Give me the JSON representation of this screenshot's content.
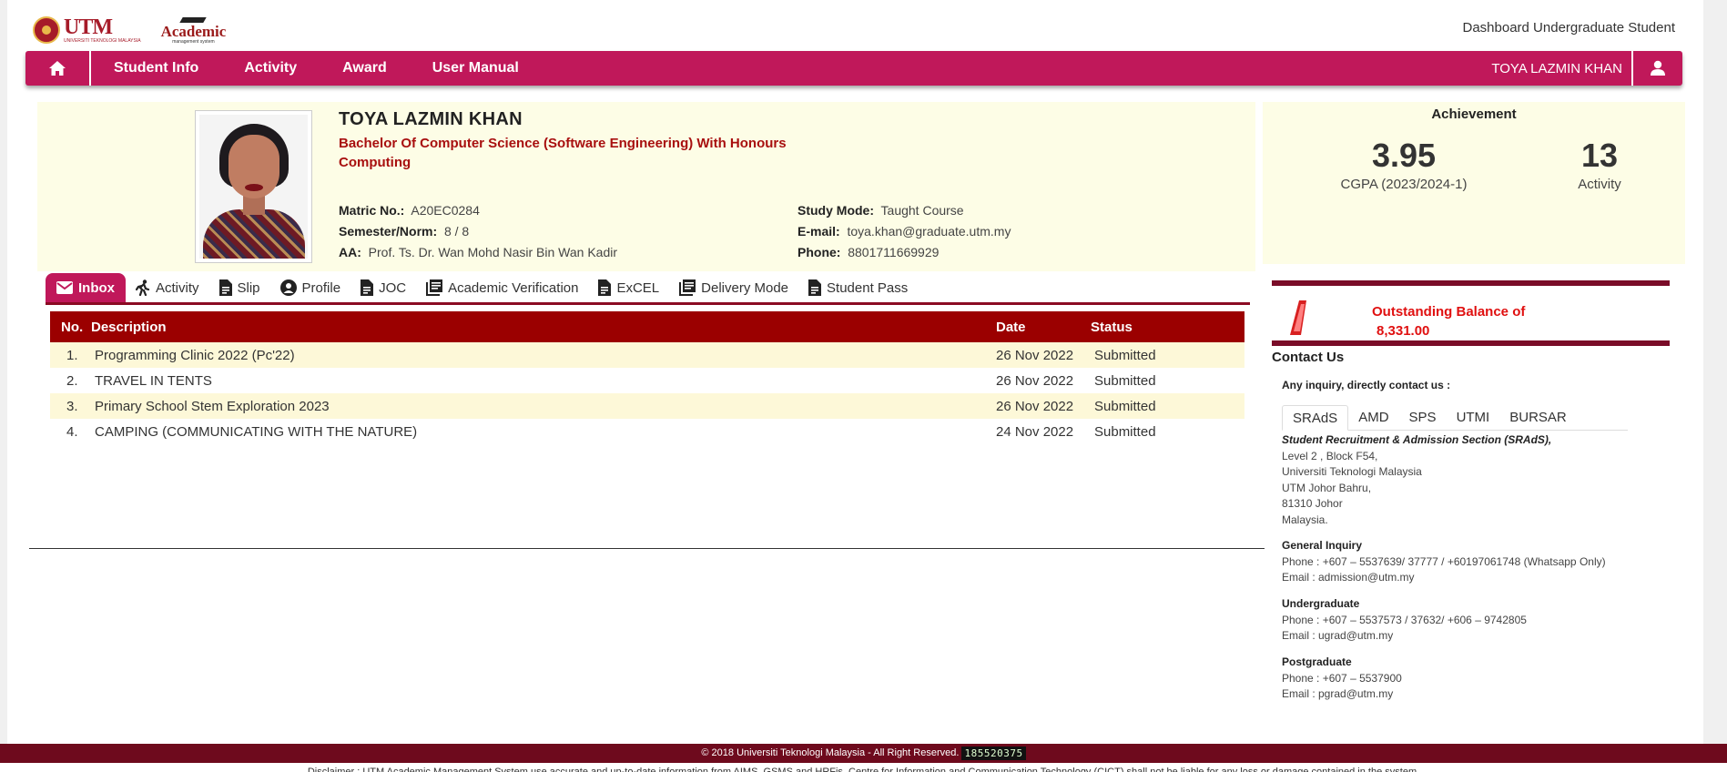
{
  "header": {
    "utm_logo_text": "UTM",
    "utm_logo_sub": "UNIVERSITI TEKNOLOGI MALAYSIA",
    "acad_logo_text": "Academic",
    "acad_logo_sub": "management system",
    "dashboard_title": "Dashboard Undergraduate Student"
  },
  "nav": {
    "items": [
      "Student Info",
      "Activity",
      "Award",
      "User Manual"
    ],
    "user_name": "TOYA LAZMIN KHAN"
  },
  "profile": {
    "name": "TOYA LAZMIN KHAN",
    "programme": "Bachelor Of Computer Science (Software Engineering) With Honours",
    "faculty": "Computing",
    "matric_label": "Matric No.:",
    "matric_value": "A20EC0284",
    "semester_label": "Semester/Norm:",
    "semester_value": "8 / 8",
    "aa_label": "AA:",
    "aa_value": "Prof. Ts. Dr. Wan Mohd Nasir Bin Wan Kadir",
    "mode_label": "Study Mode:",
    "mode_value": "Taught Course",
    "email_label": "E-mail:",
    "email_value": "toya.khan@graduate.utm.my",
    "phone_label": "Phone:",
    "phone_value": "8801711669929"
  },
  "achievement": {
    "title": "Achievement",
    "cgpa_value": "3.95",
    "cgpa_label": "CGPA (2023/2024-1)",
    "activity_value": "13",
    "activity_label": "Activity"
  },
  "outstanding": {
    "label": "Outstanding Balance of",
    "amount": "8,331.00"
  },
  "tabs": [
    "Inbox",
    "Activity",
    "Slip",
    "Profile",
    "JOC",
    "Academic Verification",
    "ExCEL",
    "Delivery Mode",
    "Student Pass"
  ],
  "inbox": {
    "headers": [
      "No.",
      "Description",
      "Date",
      "Status"
    ],
    "rows": [
      {
        "no": "1.",
        "description": "Programming Clinic 2022 (Pc'22)",
        "date": "26 Nov 2022",
        "status": "Submitted"
      },
      {
        "no": "2.",
        "description": "TRAVEL IN TENTS",
        "date": "26 Nov 2022",
        "status": "Submitted"
      },
      {
        "no": "3.",
        "description": "Primary School Stem Exploration 2023",
        "date": "26 Nov 2022",
        "status": "Submitted"
      },
      {
        "no": "4.",
        "description": "CAMPING (COMMUNICATING WITH THE NATURE)",
        "date": "24 Nov 2022",
        "status": "Submitted"
      }
    ]
  },
  "contact": {
    "title": "Contact Us",
    "subtitle": "Any inquiry, directly contact us :",
    "tabs": [
      "SRAdS",
      "AMD",
      "SPS",
      "UTMI",
      "BURSAR"
    ],
    "section_name": "Student Recruitment & Admission Section (SRAdS),",
    "address": [
      "Level 2 , Block F54,",
      "Universiti Teknologi Malaysia",
      "UTM Johor Bahru,",
      "81310 Johor",
      "Malaysia."
    ],
    "general_title": "General Inquiry",
    "general_phone": "Phone : +607 – 5537639/ 37777 / +60197061748 (Whatsapp Only)",
    "general_email": "Email : admission@utm.my",
    "ug_title": "Undergraduate",
    "ug_phone": "Phone : +607 – 5537573 / 37632/ +606 – 9742805",
    "ug_email": "Email : ugrad@utm.my",
    "pg_title": "Postgraduate",
    "pg_phone": "Phone : +607 – 5537900",
    "pg_email": "Email : pgrad@utm.my"
  },
  "footer": {
    "copyright": "© 2018 Universiti Teknologi Malaysia - All Right Reserved.",
    "counter": "185520375",
    "disclaimer": "Disclaimer : UTM Academic Management System use accurate and up-to-date information from AIMS, GSMS and HRFis. Centre for Information and Communication Technology (CICT) shall not be liable for any loss or damage contained in the system."
  },
  "colors": {
    "nav": "#c0185a",
    "table_header": "#9b0000",
    "card_bg": "#fdfde6",
    "outstanding_text": "#e01010",
    "footer": "#6e0a1d"
  }
}
